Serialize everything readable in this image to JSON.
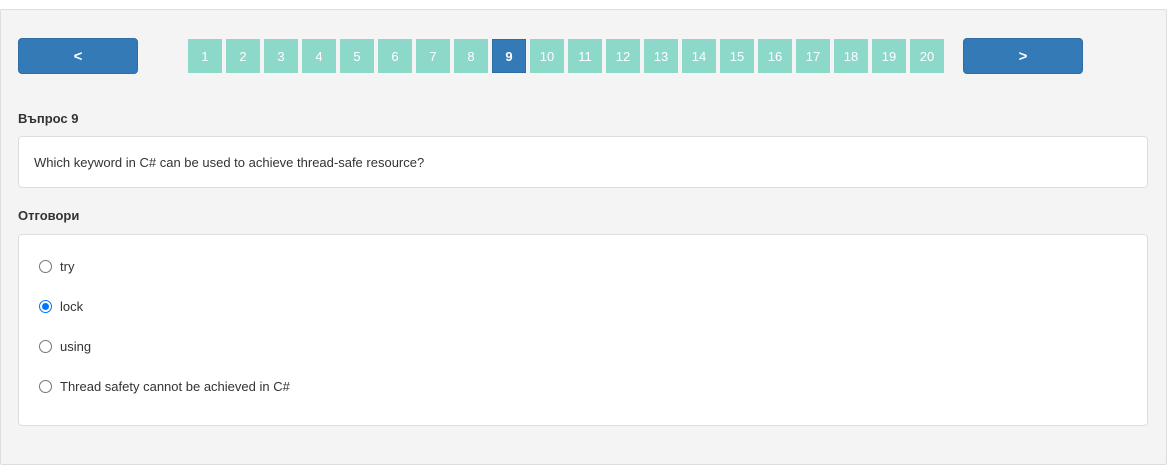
{
  "nav": {
    "prev_label": "<",
    "next_label": ">"
  },
  "pagination": {
    "pages": [
      "1",
      "2",
      "3",
      "4",
      "5",
      "6",
      "7",
      "8",
      "9",
      "10",
      "11",
      "12",
      "13",
      "14",
      "15",
      "16",
      "17",
      "18",
      "19",
      "20"
    ],
    "current": "9"
  },
  "question": {
    "heading": "Въпрос 9",
    "text": "Which keyword in C# can be used to achieve thread-safe resource?"
  },
  "answers": {
    "heading": "Отговори",
    "options": [
      {
        "label": "try",
        "checked": false
      },
      {
        "label": "lock",
        "checked": true
      },
      {
        "label": "using",
        "checked": false
      },
      {
        "label": "Thread safety cannot be achieved in C#",
        "checked": false
      }
    ]
  },
  "colors": {
    "primary": "#337ab7",
    "page_inactive": "#8dd9c9",
    "radio_checked": "#0075ff"
  }
}
